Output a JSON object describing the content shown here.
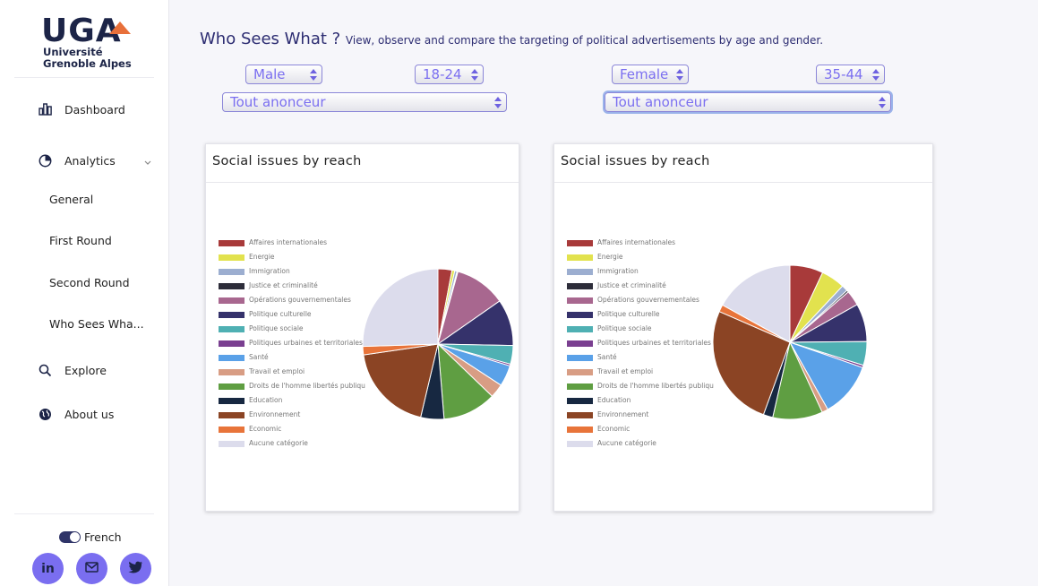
{
  "sidebar": {
    "logo": {
      "brand": "UGA",
      "line1": "Université",
      "line2": "Grenoble Alpes"
    },
    "items": [
      {
        "label": "Dashboard",
        "icon": "bar-chart-icon"
      },
      {
        "label": "Analytics",
        "icon": "pie-chart-icon"
      },
      {
        "label": "Explore",
        "icon": "search-icon"
      },
      {
        "label": "About us",
        "icon": "globe-icon"
      }
    ],
    "analytics_sub": [
      "General",
      "First Round",
      "Second Round",
      "Who Sees Wha..."
    ],
    "language": "French",
    "social": [
      {
        "label": "in",
        "icon": "linkedin-icon"
      },
      {
        "label": "",
        "icon": "mail-icon"
      },
      {
        "label": "",
        "icon": "twitter-icon"
      }
    ]
  },
  "header": {
    "title": "Who Sees What ?",
    "subtitle": "View, observe and compare the targeting of political advertisements by age and gender."
  },
  "filters": {
    "left": {
      "gender": "Male",
      "age": "18-24",
      "advertiser": "Tout anonceur"
    },
    "right": {
      "gender": "Female",
      "age": "35-44",
      "advertiser": "Tout anonceur"
    }
  },
  "colors": {
    "accent": "#7b6ff0",
    "title": "#2d2d72",
    "sidebar_dark": "#1c2447"
  },
  "chart_data": [
    {
      "type": "pie",
      "title": "Social issues by reach",
      "legend_position": "left",
      "categories": [
        "Affaires internationales",
        "Energie",
        "Immigration",
        "Justice et criminalité",
        "Opérations gouvernementales",
        "Politique culturelle",
        "Politique sociale",
        "Politiques urbaines et territoriales",
        "Santé",
        "Travail et emploi",
        "Droits de l'homme libertés publiqu",
        "Education",
        "Environnement",
        "Economic",
        "Aucune catégorie"
      ],
      "values": [
        3,
        0.6,
        0.5,
        0.2,
        11,
        10,
        4,
        0.4,
        4.5,
        3,
        11.5,
        5,
        19,
        1.8,
        25.5
      ],
      "colors": [
        "#a83a3a",
        "#e2e24e",
        "#9caed0",
        "#2d2d3a",
        "#a8678f",
        "#35326b",
        "#4fb0b3",
        "#7a3f90",
        "#5aa1e8",
        "#d89d84",
        "#5f9e42",
        "#172841",
        "#8b4424",
        "#e8743a",
        "#dcdcec"
      ]
    },
    {
      "type": "pie",
      "title": "Social issues by reach",
      "legend_position": "left",
      "categories": [
        "Affaires internationales",
        "Energie",
        "Immigration",
        "Justice et criminalité",
        "Opérations gouvernementales",
        "Politique culturelle",
        "Politique sociale",
        "Politiques urbaines et territoriales",
        "Santé",
        "Travail et emploi",
        "Droits de l'homme libertés publiqu",
        "Education",
        "Environnement",
        "Economic",
        "Aucune catégorie"
      ],
      "values": [
        7,
        5,
        1.3,
        0.4,
        3.2,
        8,
        5,
        0.5,
        11.5,
        1.3,
        10.5,
        2,
        26,
        1.5,
        17
      ],
      "colors": [
        "#a83a3a",
        "#e2e24e",
        "#9caed0",
        "#2d2d3a",
        "#a8678f",
        "#35326b",
        "#4fb0b3",
        "#7a3f90",
        "#5aa1e8",
        "#d89d84",
        "#5f9e42",
        "#172841",
        "#8b4424",
        "#e8743a",
        "#dcdcec"
      ]
    }
  ]
}
